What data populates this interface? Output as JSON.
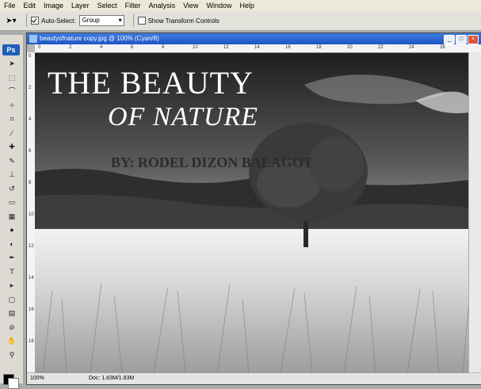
{
  "menu": [
    "File",
    "Edit",
    "Image",
    "Layer",
    "Select",
    "Filter",
    "Analysis",
    "View",
    "Window",
    "Help"
  ],
  "options": {
    "auto_select_label": "Auto-Select:",
    "auto_select_value": "Group",
    "transform_label": "Show Transform Controls"
  },
  "toolbox": {
    "logo": "Ps",
    "tools": [
      {
        "name": "move-tool-icon",
        "glyph": "➤"
      },
      {
        "name": "marquee-tool-icon",
        "glyph": "⬚"
      },
      {
        "name": "lasso-tool-icon",
        "glyph": "⌒"
      },
      {
        "name": "magic-wand-tool-icon",
        "glyph": "✧"
      },
      {
        "name": "crop-tool-icon",
        "glyph": "⌗"
      },
      {
        "name": "slice-tool-icon",
        "glyph": "∕"
      },
      {
        "name": "healing-tool-icon",
        "glyph": "✚"
      },
      {
        "name": "brush-tool-icon",
        "glyph": "✎"
      },
      {
        "name": "stamp-tool-icon",
        "glyph": "⊥"
      },
      {
        "name": "history-brush-icon",
        "glyph": "↺"
      },
      {
        "name": "eraser-tool-icon",
        "glyph": "▭"
      },
      {
        "name": "gradient-tool-icon",
        "glyph": "▦"
      },
      {
        "name": "blur-tool-icon",
        "glyph": "●"
      },
      {
        "name": "dodge-tool-icon",
        "glyph": "◐"
      },
      {
        "name": "pen-tool-icon",
        "glyph": "✒"
      },
      {
        "name": "type-tool-icon",
        "glyph": "T"
      },
      {
        "name": "path-select-icon",
        "glyph": "▸"
      },
      {
        "name": "shape-tool-icon",
        "glyph": "▢"
      },
      {
        "name": "notes-tool-icon",
        "glyph": "▤"
      },
      {
        "name": "eyedropper-tool-icon",
        "glyph": "⊘"
      },
      {
        "name": "hand-tool-icon",
        "glyph": "✋"
      },
      {
        "name": "zoom-tool-icon",
        "glyph": "⚲"
      }
    ]
  },
  "document": {
    "title": "beautyofnature copy.jpg @ 100% (Cyan/8)",
    "zoom": "100%",
    "doc_size": "Doc: 1.83M/1.83M",
    "ruler_top": [
      "0",
      "2",
      "4",
      "6",
      "8",
      "10",
      "12",
      "14",
      "16",
      "18",
      "20",
      "22",
      "24",
      "26"
    ],
    "ruler_left": [
      "0",
      "2",
      "4",
      "6",
      "8",
      "10",
      "12",
      "14",
      "16",
      "18"
    ]
  },
  "artwork": {
    "title_line1": "THE BEAUTY",
    "title_line2": "OF NATURE",
    "author": "BY: RODEL DIZON BALAGOT"
  }
}
